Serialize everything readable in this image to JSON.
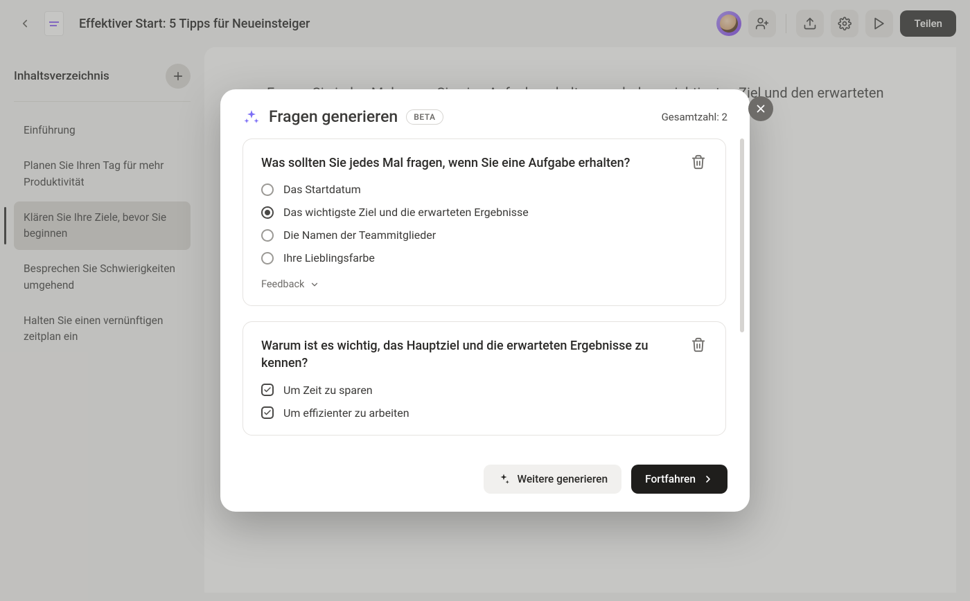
{
  "header": {
    "page_title": "Effektiver Start: 5 Tipps für Neueinsteiger",
    "share_label": "Teilen"
  },
  "sidebar": {
    "title": "Inhaltsverzeichnis",
    "items": [
      {
        "label": "Einführung",
        "active": false
      },
      {
        "label": "Planen Sie Ihren Tag für mehr Produktivität",
        "active": false
      },
      {
        "label": "Klären Sie Ihre Ziele, bevor Sie beginnen",
        "active": true
      },
      {
        "label": "Besprechen Sie Schwierigkeiten umgehend",
        "active": false
      },
      {
        "label": "Halten Sie einen vernünftigen zeitplan ein",
        "active": false
      }
    ]
  },
  "content": {
    "para1": "Fragen Sie jedes Mal, wenn Sie eine Aufgabe erhalten, nach dem wichtigsten Ziel und den erwarteten Ergebnissen. Andernfalls kann sich herausstellen, das Ergebnis auf einem"
  },
  "modal": {
    "title": "Fragen generieren",
    "beta": "BETA",
    "total_label": "Gesamtzahl: 2",
    "questions": [
      {
        "text": "Was sollten Sie jedes Mal fragen, wenn Sie eine Aufgabe erhalten?",
        "type": "single",
        "options": [
          {
            "label": "Das Startdatum",
            "selected": false
          },
          {
            "label": "Das wichtigste Ziel und die erwarteten Ergebnisse",
            "selected": true
          },
          {
            "label": "Die Namen der Teammitglieder",
            "selected": false
          },
          {
            "label": "Ihre Lieblingsfarbe",
            "selected": false
          }
        ],
        "feedback_label": "Feedback"
      },
      {
        "text": "Warum ist es wichtig, das Hauptziel und die erwarteten Ergebnisse zu kennen?",
        "type": "multiple",
        "options": [
          {
            "label": "Um Zeit zu sparen",
            "selected": true
          },
          {
            "label": "Um effizienter zu arbeiten",
            "selected": true
          }
        ]
      }
    ],
    "more_label": "Weitere generieren",
    "continue_label": "Fortfahren"
  }
}
